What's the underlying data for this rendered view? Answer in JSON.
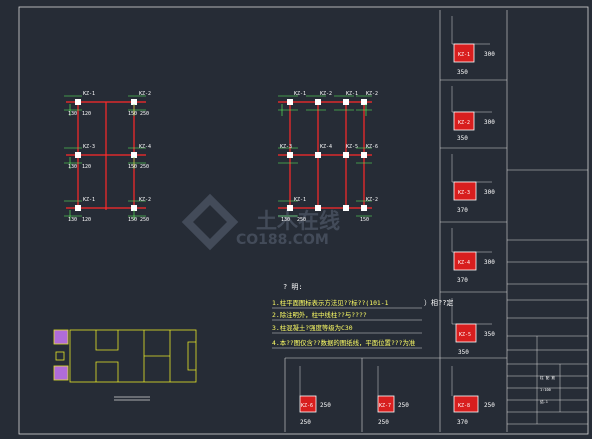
{
  "notes": {
    "title": "? 明:",
    "lines": [
      "1.柱平面图标表示方法见??标??(101-1",
      "2.除注明外，柱中线柱??与????",
      "3.柱混凝土?强度等级为C30",
      "4.本??图仅含??数据的图纸线，平面位置???为准"
    ],
    "trailing": "）相??定"
  },
  "plan_left": {
    "columns": [
      "KZ-1",
      "KZ-2",
      "KZ-3",
      "KZ-4",
      "KZ-1",
      "KZ-2"
    ],
    "dims": [
      "130",
      "120",
      "150",
      "250",
      "130",
      "120",
      "150",
      "250",
      "130",
      "120",
      "150",
      "250"
    ]
  },
  "plan_right": {
    "columns": [
      "KZ-1",
      "KZ-2",
      "KZ-1",
      "KZ-2",
      "KZ-3",
      "KZ-4",
      "KZ-5",
      "KZ-6",
      "KZ-1",
      "KZ-2"
    ],
    "dims": [
      "130",
      "250",
      "150"
    ]
  },
  "sections": [
    {
      "name": "KZ-1",
      "width": "350",
      "height": "300"
    },
    {
      "name": "KZ-2",
      "width": "350",
      "height": "300"
    },
    {
      "name": "KZ-3",
      "width": "370",
      "height": "300"
    },
    {
      "name": "KZ-4",
      "width": "370",
      "height": "300"
    },
    {
      "name": "KZ-5",
      "width": "350",
      "height": "350"
    },
    {
      "name": "KZ-6",
      "width": "250",
      "height": "250"
    },
    {
      "name": "KZ-7",
      "width": "250",
      "height": "250"
    },
    {
      "name": "KZ-8",
      "width": "370",
      "height": "250"
    }
  ],
  "watermark": {
    "brand": "土木在线",
    "url": "CO188.COM"
  },
  "title_block": {
    "drawing_name": "柱 配 筋",
    "scale": "1:100",
    "sheet_no": "结-1"
  }
}
